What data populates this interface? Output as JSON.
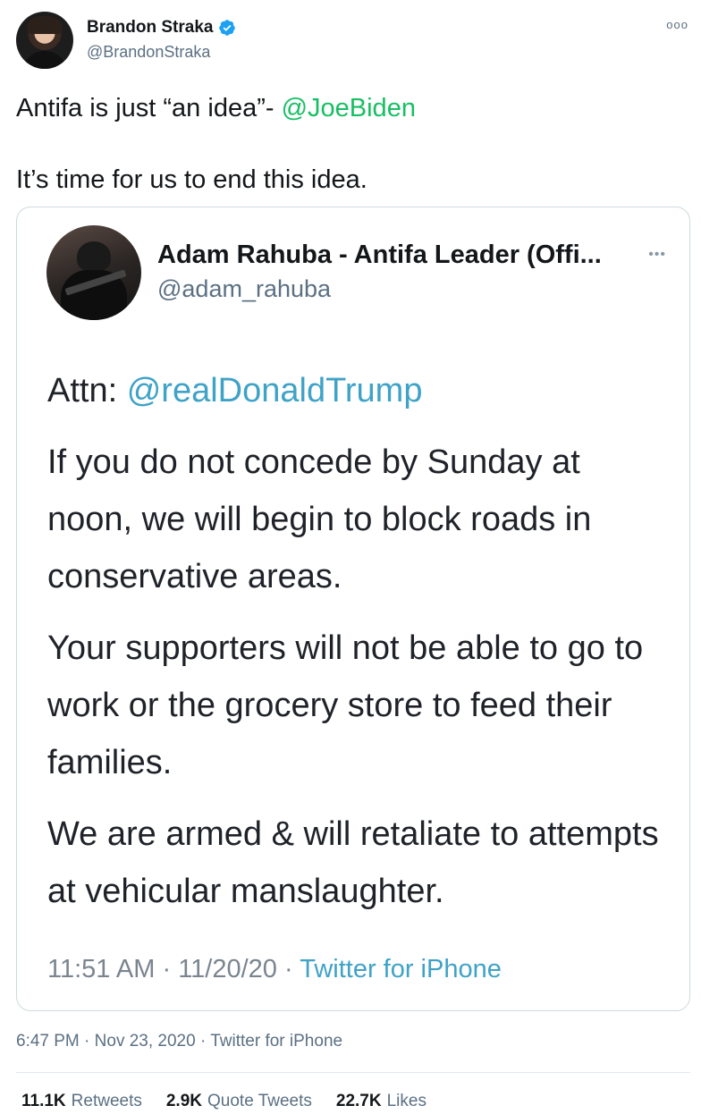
{
  "tweet": {
    "author": {
      "name": "Brandon Straka",
      "handle": "@BrandonStraka"
    },
    "more_label": "ooo",
    "text": {
      "line1_prefix": "Antifa is just “an idea”- ",
      "line1_mention": "@JoeBiden",
      "line2": "It’s time for us to end this idea."
    },
    "meta": {
      "time": "6:47 PM",
      "date": "Nov 23, 2020",
      "source": "Twitter for iPhone",
      "separator": "·"
    },
    "stats": [
      {
        "count": "11.1K",
        "label": "Retweets"
      },
      {
        "count": "2.9K",
        "label": "Quote Tweets"
      },
      {
        "count": "22.7K",
        "label": "Likes"
      }
    ]
  },
  "quoted": {
    "author": {
      "name": "Adam Rahuba - Antifa Leader (Offi...",
      "handle": "@adam_rahuba"
    },
    "more_label": "•••",
    "attn_prefix": "Attn: ",
    "attn_mention": "@realDonaldTrump",
    "paragraphs": [
      "If you do not concede by Sunday at noon, we will begin to block roads in conservative areas.",
      "Your supporters will not be able to go to work or the grocery store to feed their families.",
      "We are armed & will retaliate to attempts at vehicular manslaughter."
    ],
    "meta": {
      "time": "11:51 AM",
      "date": "11/20/20",
      "source": "Twitter for iPhone",
      "separator": "·"
    }
  },
  "colors": {
    "green_mention": "#17bf63",
    "blue_link": "#3fa2c7",
    "verified_badge": "#1da1f2"
  },
  "icons": {
    "verified": "verified-badge-icon",
    "more": "more-options-icon"
  }
}
